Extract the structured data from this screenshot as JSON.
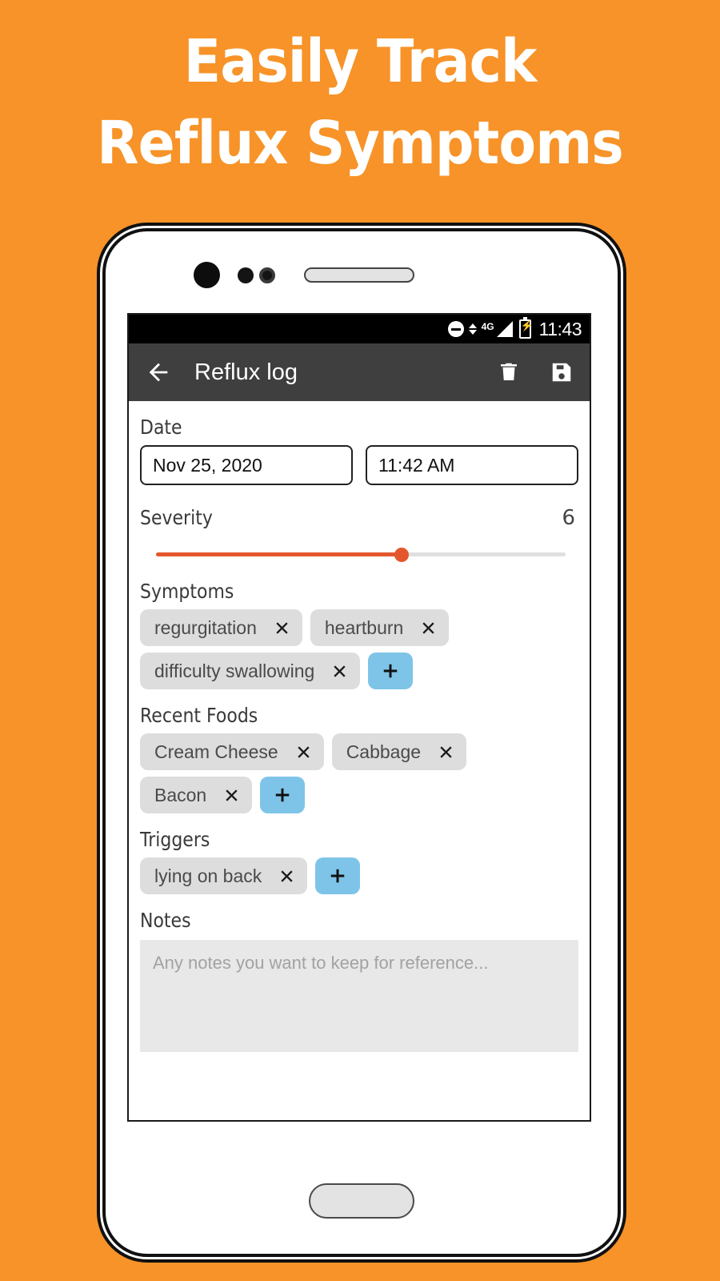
{
  "promo": {
    "headline_line1": "Easily Track",
    "headline_line2": "Reflux Symptoms",
    "background_color": "#F79328"
  },
  "status_bar": {
    "time": "11:43",
    "network": "4G",
    "icons": [
      "do-not-disturb-icon",
      "data-transfer-arrows-icon",
      "signal-icon",
      "battery-charging-icon"
    ]
  },
  "toolbar": {
    "title": "Reflux log",
    "back_icon": "back-arrow-icon",
    "delete_icon": "trash-icon",
    "save_icon": "floppy-save-icon",
    "background_color": "#3F3F3F"
  },
  "form": {
    "date": {
      "label": "Date",
      "date_value": "Nov 25, 2020",
      "time_value": "11:42 AM"
    },
    "severity": {
      "label": "Severity",
      "value": "6",
      "min": 0,
      "max": 10,
      "percent": 60,
      "fill_color": "#E4572E",
      "track_color": "#E0E0E0"
    },
    "symptoms": {
      "label": "Symptoms",
      "chips": [
        "regurgitation",
        "heartburn",
        "difficulty swallowing"
      ],
      "add_label": "+"
    },
    "recent_foods": {
      "label": "Recent Foods",
      "chips": [
        "Cream Cheese",
        "Cabbage",
        "Bacon"
      ],
      "add_label": "+"
    },
    "triggers": {
      "label": "Triggers",
      "chips": [
        "lying on back"
      ],
      "add_label": "+"
    },
    "notes": {
      "label": "Notes",
      "placeholder": "Any notes you want to keep for reference...",
      "value": ""
    },
    "chip_color": "#DDDDDD",
    "add_button_color": "#7EC4E8"
  }
}
